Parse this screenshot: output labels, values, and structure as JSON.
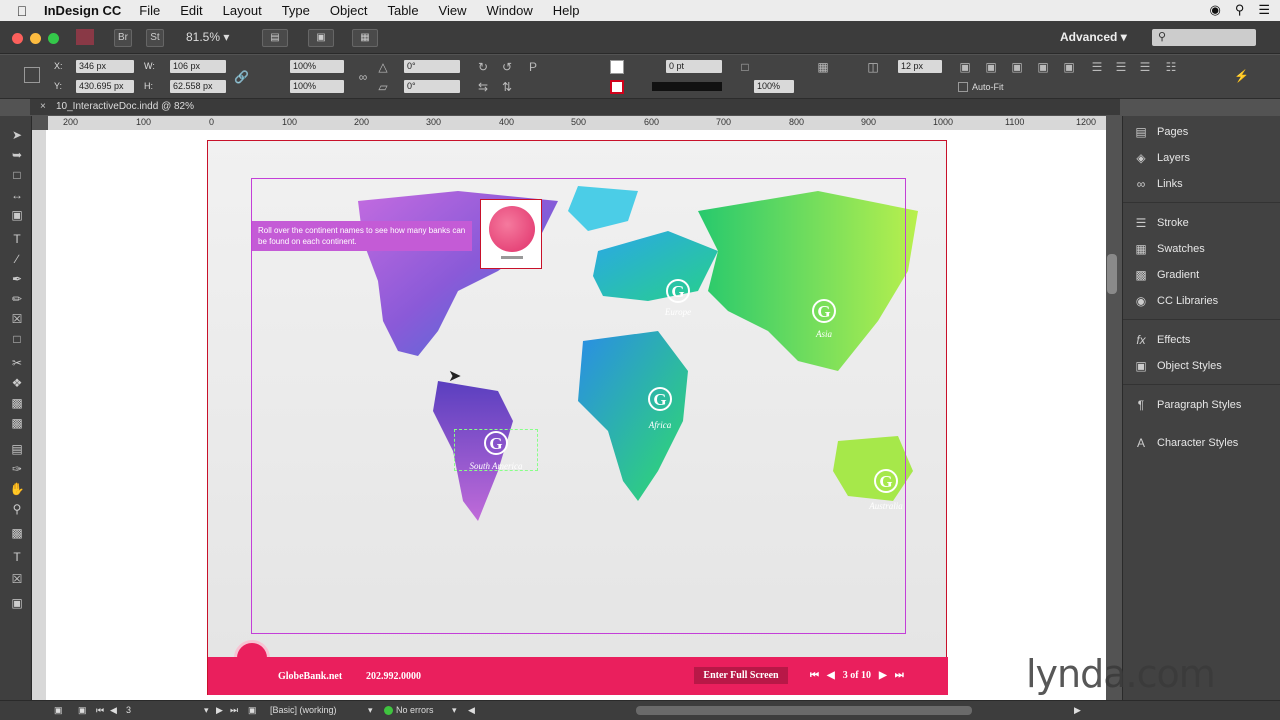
{
  "menubar": {
    "app_name": "InDesign CC",
    "items": [
      "File",
      "Edit",
      "Layout",
      "Type",
      "Object",
      "Table",
      "View",
      "Window",
      "Help"
    ]
  },
  "appbar": {
    "bridge": "Br",
    "stock": "St",
    "zoom": "81.5%",
    "workspace": "Advanced",
    "search_placeholder": ""
  },
  "control": {
    "x_label": "X:",
    "x_value": "346 px",
    "y_label": "Y:",
    "y_value": "430.695 px",
    "w_label": "W:",
    "w_value": "106 px",
    "h_label": "H:",
    "h_value": "62.558 px",
    "scale_x": "100%",
    "scale_y": "100%",
    "rotate": "0°",
    "shear": "0°",
    "stroke_weight": "0 pt",
    "opacity": "100%",
    "gutter": "12 px",
    "autofit": "Auto-Fit"
  },
  "doc": {
    "tab_title": "10_InteractiveDoc.indd @ 82%"
  },
  "ruler": {
    "ticks": [
      "200",
      "100",
      "0",
      "100",
      "200",
      "300",
      "400",
      "500",
      "600",
      "700",
      "800",
      "900",
      "1000",
      "1100",
      "1200"
    ]
  },
  "page": {
    "callout": "Roll over the continent names to see how many banks can be found on each continent.",
    "continents": {
      "europe": "Europe",
      "asia": "Asia",
      "africa": "Africa",
      "south_america": "South America",
      "australia": "Australia"
    },
    "gmark": "G",
    "footer": {
      "site": "GlobeBank.net",
      "phone": "202.992.0000",
      "fullscreen": "Enter Full Screen",
      "pager": "3 of 10"
    }
  },
  "panels": {
    "items": [
      "Pages",
      "Layers",
      "Links",
      "Stroke",
      "Swatches",
      "Gradient",
      "CC Libraries",
      "Effects",
      "Object Styles",
      "Paragraph Styles",
      "Character Styles"
    ],
    "icons": [
      "pages-icon",
      "layers-icon",
      "links-icon",
      "stroke-icon",
      "swatches-icon",
      "gradient-icon",
      "cc-libraries-icon",
      "effects-icon",
      "object-styles-icon",
      "paragraph-styles-icon",
      "character-styles-icon"
    ]
  },
  "status": {
    "page": "3",
    "style": "[Basic] (working)",
    "errors": "No errors"
  },
  "watermark": "lynda.com",
  "colors": {
    "accent_pink": "#ea1f5d",
    "frame_magenta": "#c33fd8",
    "page_border": "#c8112a"
  }
}
